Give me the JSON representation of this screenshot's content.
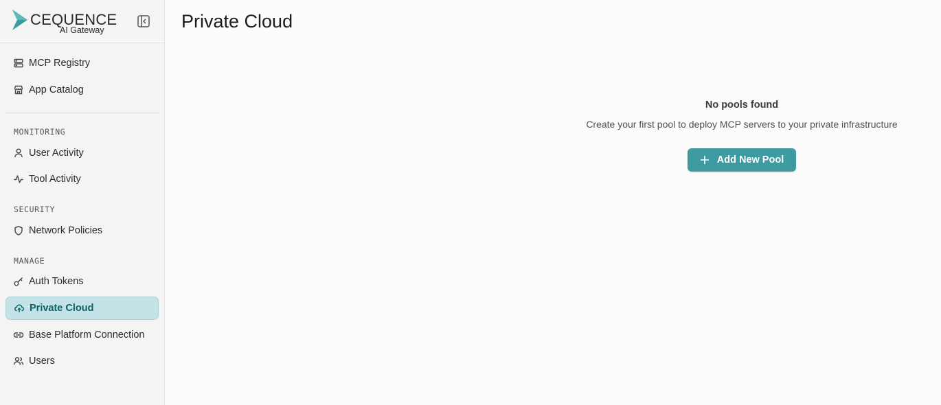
{
  "brand": {
    "name": "CEQUENCE",
    "subtitle": "AI Gateway",
    "accent": "#3c9aa0"
  },
  "sidebar": {
    "top_items": [
      {
        "label": "MCP Registry",
        "icon": "server-icon"
      },
      {
        "label": "App Catalog",
        "icon": "store-icon"
      }
    ],
    "sections": [
      {
        "title": "MONITORING",
        "items": [
          {
            "label": "User Activity",
            "icon": "user-icon"
          },
          {
            "label": "Tool Activity",
            "icon": "activity-icon"
          }
        ]
      },
      {
        "title": "SECURITY",
        "items": [
          {
            "label": "Network Policies",
            "icon": "shield-icon"
          }
        ]
      },
      {
        "title": "MANAGE",
        "items": [
          {
            "label": "Auth Tokens",
            "icon": "key-icon"
          },
          {
            "label": "Private Cloud",
            "icon": "cloud-upload-icon",
            "active": true
          },
          {
            "label": "Base Platform Connection",
            "icon": "link-icon"
          },
          {
            "label": "Users",
            "icon": "users-icon"
          }
        ]
      }
    ]
  },
  "main": {
    "title": "Private Cloud",
    "empty_state": {
      "title": "No pools found",
      "message": "Create your first pool to deploy MCP servers to your private infrastructure",
      "button_label": "Add New Pool"
    }
  }
}
